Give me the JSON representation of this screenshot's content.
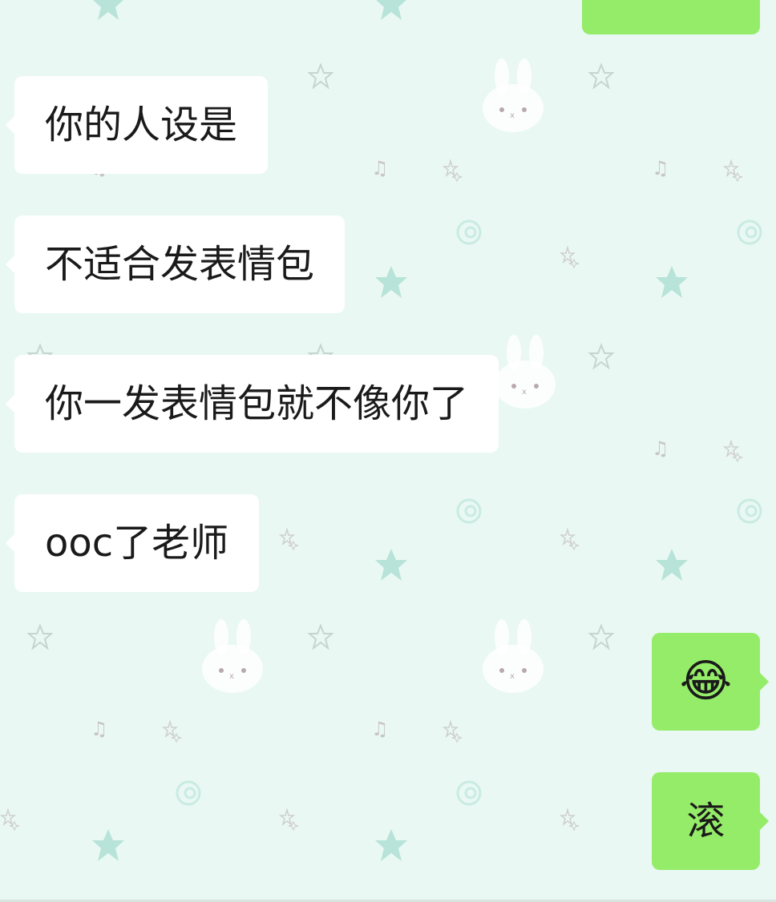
{
  "colors": {
    "background": "#e9f8f3",
    "incoming_bubble": "#ffffff",
    "outgoing_bubble": "#95ec69",
    "text": "#1a1a1a"
  },
  "messages": [
    {
      "direction": "outgoing",
      "text": ""
    },
    {
      "direction": "incoming",
      "text": "你的人设是"
    },
    {
      "direction": "incoming",
      "text": "不适合发表情包"
    },
    {
      "direction": "incoming",
      "text": "你一发表情包就不像你了"
    },
    {
      "direction": "incoming",
      "text": "ooc了老师"
    },
    {
      "direction": "outgoing",
      "text": "😂",
      "icon": "laughing-tears-emoji"
    },
    {
      "direction": "outgoing",
      "text": "滚"
    }
  ]
}
